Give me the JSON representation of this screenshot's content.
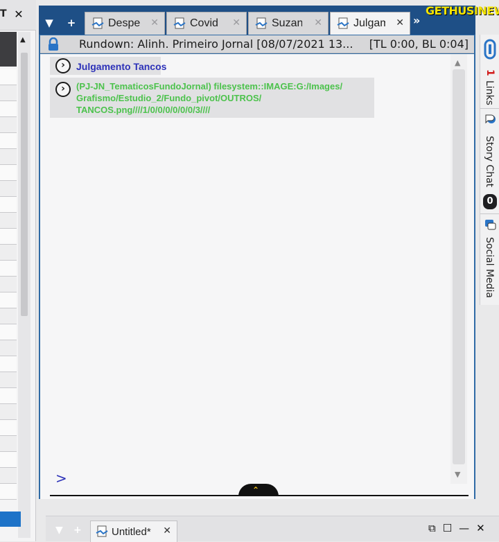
{
  "left_panel": {
    "partial_glyph": "T",
    "close_label": "✕"
  },
  "tabs": {
    "dropdown_label": "▼",
    "add_label": "+",
    "more_label": "»",
    "items": [
      {
        "label": "Despe",
        "icon": "story-doc-icon",
        "close": "✕"
      },
      {
        "label": "Covid",
        "icon": "story-doc-icon",
        "close": "✕"
      },
      {
        "label": "Suzana",
        "icon": "story-doc-icon",
        "close": "✕"
      },
      {
        "label": "Julgam",
        "icon": "story-doc-icon",
        "close": "✕",
        "active": true
      }
    ]
  },
  "rundown": {
    "icon": "lock-icon",
    "title": "Rundown: Alinh. Primeiro Jornal [08/07/2021 13...",
    "timing": "[TL 0:00, BL 0:04]"
  },
  "story": {
    "expand_symbol": "›",
    "title": "Julgamento Tancos",
    "mos_lines": [
      "(PJ-JN_TematicosFundoJornal) filesystem::IMAGE:G:/Images/",
      "Grafismo/Estudio_2/Fundo_pivot/OUTROS/",
      "TANCOS.png////1/0/0/0/0/0/0/3////"
    ],
    "prompt": ">"
  },
  "side_panel": {
    "links_count": "1",
    "links_label": "Links",
    "story_chat_label": "Story Chat",
    "story_chat_count": "0",
    "social_media_label": "Social Media"
  },
  "watermark": "GETHUSINEWS",
  "bottom_window": {
    "tab_label": "Untitled*",
    "tab_close": "✕",
    "popout": "⧉",
    "restore": "☐",
    "minimize": "—",
    "close": "✕"
  },
  "colors": {
    "tabbar": "#1e4f86",
    "story_title": "#2c31b8",
    "mos_text": "#4cc24c",
    "accent_blue": "#1e73c8",
    "links_count": "#d11a1a"
  }
}
